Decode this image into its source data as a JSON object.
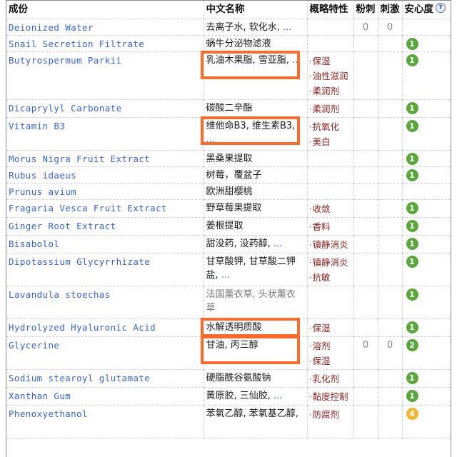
{
  "table": {
    "headers": {
      "ingredient": "成份",
      "chinese_name": "中文名称",
      "function": "概略特性",
      "acne": "粉刺",
      "irritation": "刺激",
      "safety": "安心度",
      "help_icon": "?"
    },
    "rows": [
      {
        "inci": "Deionized Water",
        "cn": "去离子水, 软化水,",
        "cn_ellipsis": " ...",
        "functions": [],
        "acne": "0",
        "irritation": "0",
        "safety": ""
      },
      {
        "inci": "Snail Secretion Filtrate",
        "cn": "蜗牛分泌物滤液",
        "cn_ellipsis": "",
        "functions": [],
        "acne": "",
        "irritation": "",
        "safety": "1"
      },
      {
        "inci": "Butyrospermum Parkii",
        "cn": "乳油木果脂, 雪亚脂,",
        "cn_ellipsis": " ...",
        "functions": [
          "保湿",
          "油性滋润",
          "柔润剂"
        ],
        "acne": "",
        "irritation": "",
        "safety": "1",
        "highlighted": true
      },
      {
        "inci": "Dicaprylyl Carbonate",
        "cn": "碳酸二辛酯",
        "cn_ellipsis": "",
        "functions": [
          "柔润剂"
        ],
        "acne": "",
        "irritation": "",
        "safety": "1"
      },
      {
        "inci": "Vitamin B3",
        "cn": "维他命B3, 维生素B3,",
        "cn_ellipsis": " ...",
        "functions": [
          "抗氧化",
          "美白"
        ],
        "acne": "",
        "irritation": "",
        "safety": "1",
        "highlighted": true
      },
      {
        "inci": "Morus Nigra Fruit Extract",
        "cn": "黑桑果提取",
        "cn_ellipsis": "",
        "functions": [],
        "acne": "",
        "irritation": "",
        "safety": "1"
      },
      {
        "inci": "Rubus idaeus",
        "cn": "树莓，覆盆子",
        "cn_ellipsis": "",
        "functions": [],
        "acne": "",
        "irritation": "",
        "safety": "1"
      },
      {
        "inci": "Prunus avium",
        "cn": "欧洲甜樱桃",
        "cn_ellipsis": "",
        "functions": [],
        "acne": "",
        "irritation": "",
        "safety": ""
      },
      {
        "inci": "Fragaria Vesca Fruit Extract",
        "cn": "野草莓果提取",
        "cn_ellipsis": "",
        "functions": [
          "收敛"
        ],
        "acne": "",
        "irritation": "",
        "safety": "1"
      },
      {
        "inci": "Ginger Root Extract",
        "cn": "姜根提取",
        "cn_ellipsis": "",
        "functions": [
          "香料"
        ],
        "acne": "",
        "irritation": "",
        "safety": "1"
      },
      {
        "inci": "Bisabolol",
        "cn": "甜没药, 没药醇,",
        "cn_ellipsis": " ...",
        "functions": [
          "镇静消炎"
        ],
        "acne": "",
        "irritation": "",
        "safety": "1"
      },
      {
        "inci": "Dipotassium Glycyrrhizate",
        "cn": "甘草酸钾, 甘草酸二钾盐,",
        "cn_ellipsis": " ...",
        "functions": [
          "镇静消炎",
          "抗敏"
        ],
        "acne": "",
        "irritation": "",
        "safety": "1"
      },
      {
        "inci": "Lavandula stoechas",
        "cn": "法国薰衣草, 头状薰衣草",
        "cn_ellipsis": "",
        "functions": [],
        "acne": "",
        "irritation": "",
        "safety": "1",
        "grey": true
      },
      {
        "inci": "Hydrolyzed Hyaluronic Acid",
        "cn": "水解透明质酸",
        "cn_ellipsis": "",
        "functions": [
          "保湿"
        ],
        "acne": "",
        "irritation": "",
        "safety": "1",
        "highlighted": true
      },
      {
        "inci": "Glycerine",
        "cn": "甘油, 丙三醇",
        "cn_ellipsis": "",
        "functions": [
          "溶剂",
          "保湿"
        ],
        "acne": "0",
        "irritation": "0",
        "safety": "2",
        "highlighted": true
      },
      {
        "inci": "Sodium stearoyl glutamate",
        "cn": "硬脂酰谷氨酸钠",
        "cn_ellipsis": "",
        "functions": [
          "乳化剂"
        ],
        "acne": "",
        "irritation": "",
        "safety": "1"
      },
      {
        "inci": "Xanthan Gum",
        "cn": "黄原胶, 三仙胶,",
        "cn_ellipsis": " ...",
        "functions": [
          "黏度控制"
        ],
        "acne": "",
        "irritation": "",
        "safety": "1"
      },
      {
        "inci": "Phenoxyethanol",
        "cn": "苯氧乙醇, 苯氧基乙醇,",
        "cn_ellipsis": "",
        "functions": [
          "防腐剂"
        ],
        "acne": "",
        "irritation": "",
        "safety": "4"
      }
    ]
  },
  "colors": {
    "link": "#3a63d0",
    "function_text": "#8b1e1e",
    "safe_badge": "#5aa83c",
    "warn_badge": "#f4b630",
    "highlight_box": "#ff6a2e"
  }
}
